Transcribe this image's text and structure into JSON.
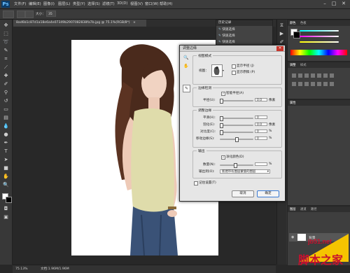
{
  "app": {
    "logo": "Ps",
    "window_min": "–",
    "window_max": "□",
    "window_close": "✕"
  },
  "menu": [
    "文件(F)",
    "编辑(E)",
    "图像(I)",
    "图层(L)",
    "类型(Y)",
    "选择(S)",
    "滤镜(T)",
    "3D(D)",
    "视图(V)",
    "窗口(W)",
    "帮助(H)"
  ],
  "options": {
    "size_label": "大小：",
    "size_value": "35"
  },
  "document": {
    "tab_title": "8ad6b1c87d1a18e6a4e07349b2907082838fa7b.jpg @ 75.1%(RGB/8*)",
    "tab_close": "×"
  },
  "status": {
    "zoom": "75.13%",
    "doc_info": "文档:1.96M/1.96M"
  },
  "history_panel": {
    "title": "历史记录",
    "items": [
      "快速选择",
      "快速选择",
      "快速选择",
      "快速选择",
      "快速选择"
    ]
  },
  "right_panels": {
    "color_tabs": [
      "颜色",
      "色板"
    ],
    "adjust_tabs": [
      "调整",
      "样式"
    ],
    "props_tabs": [
      "属性"
    ],
    "layers_tabs": [
      "图层",
      "通道",
      "路径"
    ],
    "layer_name": "背景",
    "colors": {
      "fg": "#ffffff",
      "bg": "#000000"
    }
  },
  "dialog": {
    "title": "调整边缘",
    "close": "✕",
    "view_mode": {
      "label": "视图模式",
      "view_label": "视图：",
      "show_radius": "显示半径 (J)",
      "show_original": "显示原稿 (P)"
    },
    "edge_detection": {
      "label": "边缘检测",
      "smart_radius": "智能半径(A)",
      "radius_label": "半径(U):",
      "radius_value": "0.0",
      "radius_unit": "像素"
    },
    "adjust_edge": {
      "label": "调整边缘",
      "smooth_label": "平滑(H):",
      "smooth_value": "0",
      "feather_label": "羽化(E):",
      "feather_value": "0.0",
      "feather_unit": "像素",
      "contrast_label": "对比度(C):",
      "contrast_value": "0",
      "contrast_unit": "%",
      "shift_label": "移动边缘(S):",
      "shift_value": "0",
      "shift_unit": "%"
    },
    "output": {
      "label": "输出",
      "decontaminate": "净化颜色(D)",
      "amount_label": "数量(N):",
      "amount_value": "",
      "amount_unit": "%",
      "output_to_label": "输出到(O):",
      "output_to_value": "新建带有图层蒙版的图层"
    },
    "remember": "记住设置(T)",
    "cancel": "取消",
    "ok": "确定"
  },
  "annotation": {
    "arrow_color": "#e0251b"
  },
  "watermark": {
    "url": "jb51.net",
    "text": "脚本之家"
  }
}
